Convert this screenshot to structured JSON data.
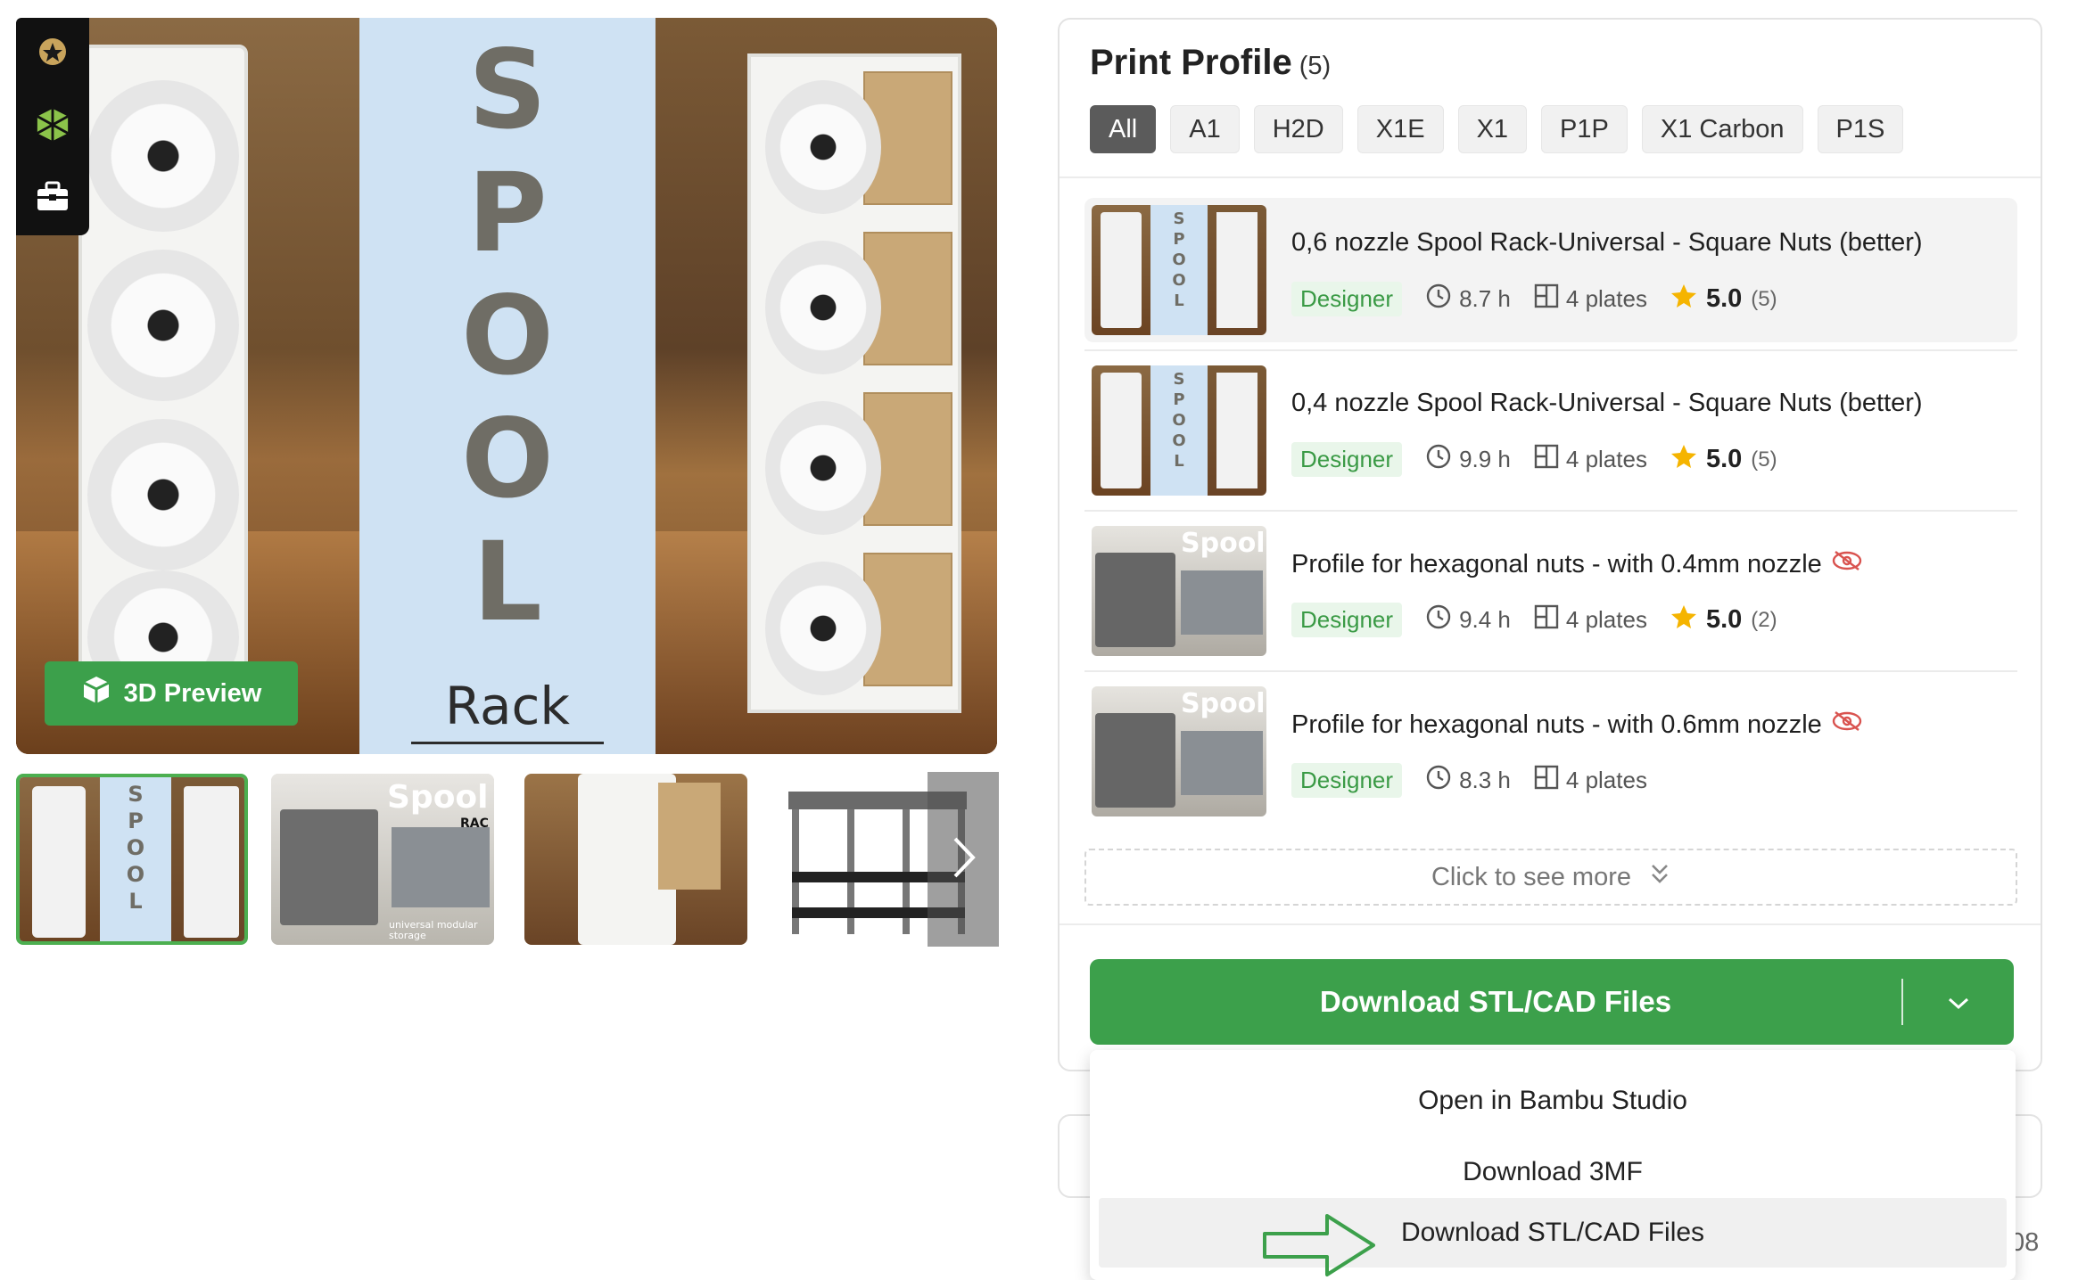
{
  "gallery": {
    "preview_button": "3D Preview",
    "hero_sign": {
      "letters": [
        "S",
        "P",
        "O",
        "O",
        "L"
      ],
      "subtitle": "Rack"
    },
    "thumbnails": [
      {
        "overlay": "",
        "active": true
      },
      {
        "overlay": "Spool",
        "overlay_small": "RAC",
        "caption": "universal modular storage",
        "active": false
      },
      {
        "overlay": "",
        "active": false
      },
      {
        "overlay": "",
        "active": false
      }
    ],
    "sidebar_icons": [
      "award-badge-icon",
      "cube-grid-icon",
      "toolbox-icon"
    ]
  },
  "profile_card": {
    "title": "Print Profile",
    "count": "(5)",
    "filters": [
      "All",
      "A1",
      "H2D",
      "X1E",
      "X1",
      "P1P",
      "X1 Carbon",
      "P1S"
    ],
    "active_filter": "All",
    "profiles": [
      {
        "name": "0,6 nozzle Spool Rack-Universal - Square Nuts (better)",
        "tag": "Designer",
        "time": "8.7 h",
        "plates": "4 plates",
        "rating": "5.0",
        "rating_count": "(5)",
        "hidden": false,
        "thumb": "spool"
      },
      {
        "name": "0,4 nozzle Spool Rack-Universal - Square Nuts (better)",
        "tag": "Designer",
        "time": "9.9 h",
        "plates": "4 plates",
        "rating": "5.0",
        "rating_count": "(5)",
        "hidden": false,
        "thumb": "spool"
      },
      {
        "name": "Profile for hexagonal nuts - with 0.4mm nozzle",
        "tag": "Designer",
        "time": "9.4 h",
        "plates": "4 plates",
        "rating": "5.0",
        "rating_count": "(2)",
        "hidden": true,
        "thumb": "printer"
      },
      {
        "name": "Profile for hexagonal nuts - with 0.6mm nozzle",
        "tag": "Designer",
        "time": "8.3 h",
        "plates": "4 plates",
        "rating": "",
        "rating_count": "",
        "hidden": true,
        "thumb": "printer"
      }
    ],
    "see_more": "Click to see more",
    "download_button": "Download STL/CAD Files"
  },
  "dropdown": {
    "items": [
      "Open in Bambu Studio",
      "Download 3MF",
      "Download STL/CAD Files"
    ],
    "highlighted": "Download STL/CAD Files"
  },
  "background_text": "08",
  "colors": {
    "accent": "#3ca04b",
    "tag_bg": "#e9f6ea",
    "star": "#f5b400",
    "hidden_icon": "#d9534f"
  }
}
